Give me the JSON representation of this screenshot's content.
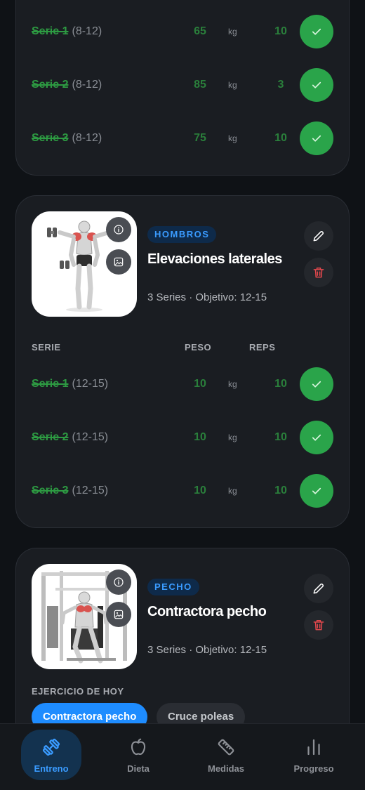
{
  "workout_cards": [
    {
      "sets": [
        {
          "label": "Serie 1",
          "range": "(8-12)",
          "weight": "65",
          "unit": "kg",
          "reps": "10"
        },
        {
          "label": "Serie 2",
          "range": "(8-12)",
          "weight": "85",
          "unit": "kg",
          "reps": "3"
        },
        {
          "label": "Serie 3",
          "range": "(8-12)",
          "weight": "75",
          "unit": "kg",
          "reps": "10"
        }
      ]
    },
    {
      "tag": "HOMBROS",
      "title": "Elevaciones laterales",
      "meta": "3 Series · Objetivo: 12-15",
      "headers": {
        "set": "SERIE",
        "weight": "PESO",
        "reps": "REPS"
      },
      "sets": [
        {
          "label": "Serie 1",
          "range": "(12-15)",
          "weight": "10",
          "unit": "kg",
          "reps": "10"
        },
        {
          "label": "Serie 2",
          "range": "(12-15)",
          "weight": "10",
          "unit": "kg",
          "reps": "10"
        },
        {
          "label": "Serie 3",
          "range": "(12-15)",
          "weight": "10",
          "unit": "kg",
          "reps": "10"
        }
      ]
    },
    {
      "tag": "PECHO",
      "title": "Contractora pecho",
      "meta": "3 Series · Objetivo: 12-15",
      "today_label": "EJERCICIO DE HOY",
      "chips": [
        "Contractora pecho",
        "Cruce poleas"
      ]
    }
  ],
  "nav": [
    {
      "label": "Entreno",
      "icon": "dumbbell-icon",
      "active": true
    },
    {
      "label": "Dieta",
      "icon": "apple-icon",
      "active": false
    },
    {
      "label": "Medidas",
      "icon": "ruler-icon",
      "active": false
    },
    {
      "label": "Progreso",
      "icon": "bar-chart-icon",
      "active": false
    }
  ],
  "colors": {
    "background": "#0f1216",
    "card": "#1a1d22",
    "accent_blue": "#1e8cff",
    "success_green": "#2aa44a",
    "danger_red": "#e5484d"
  }
}
